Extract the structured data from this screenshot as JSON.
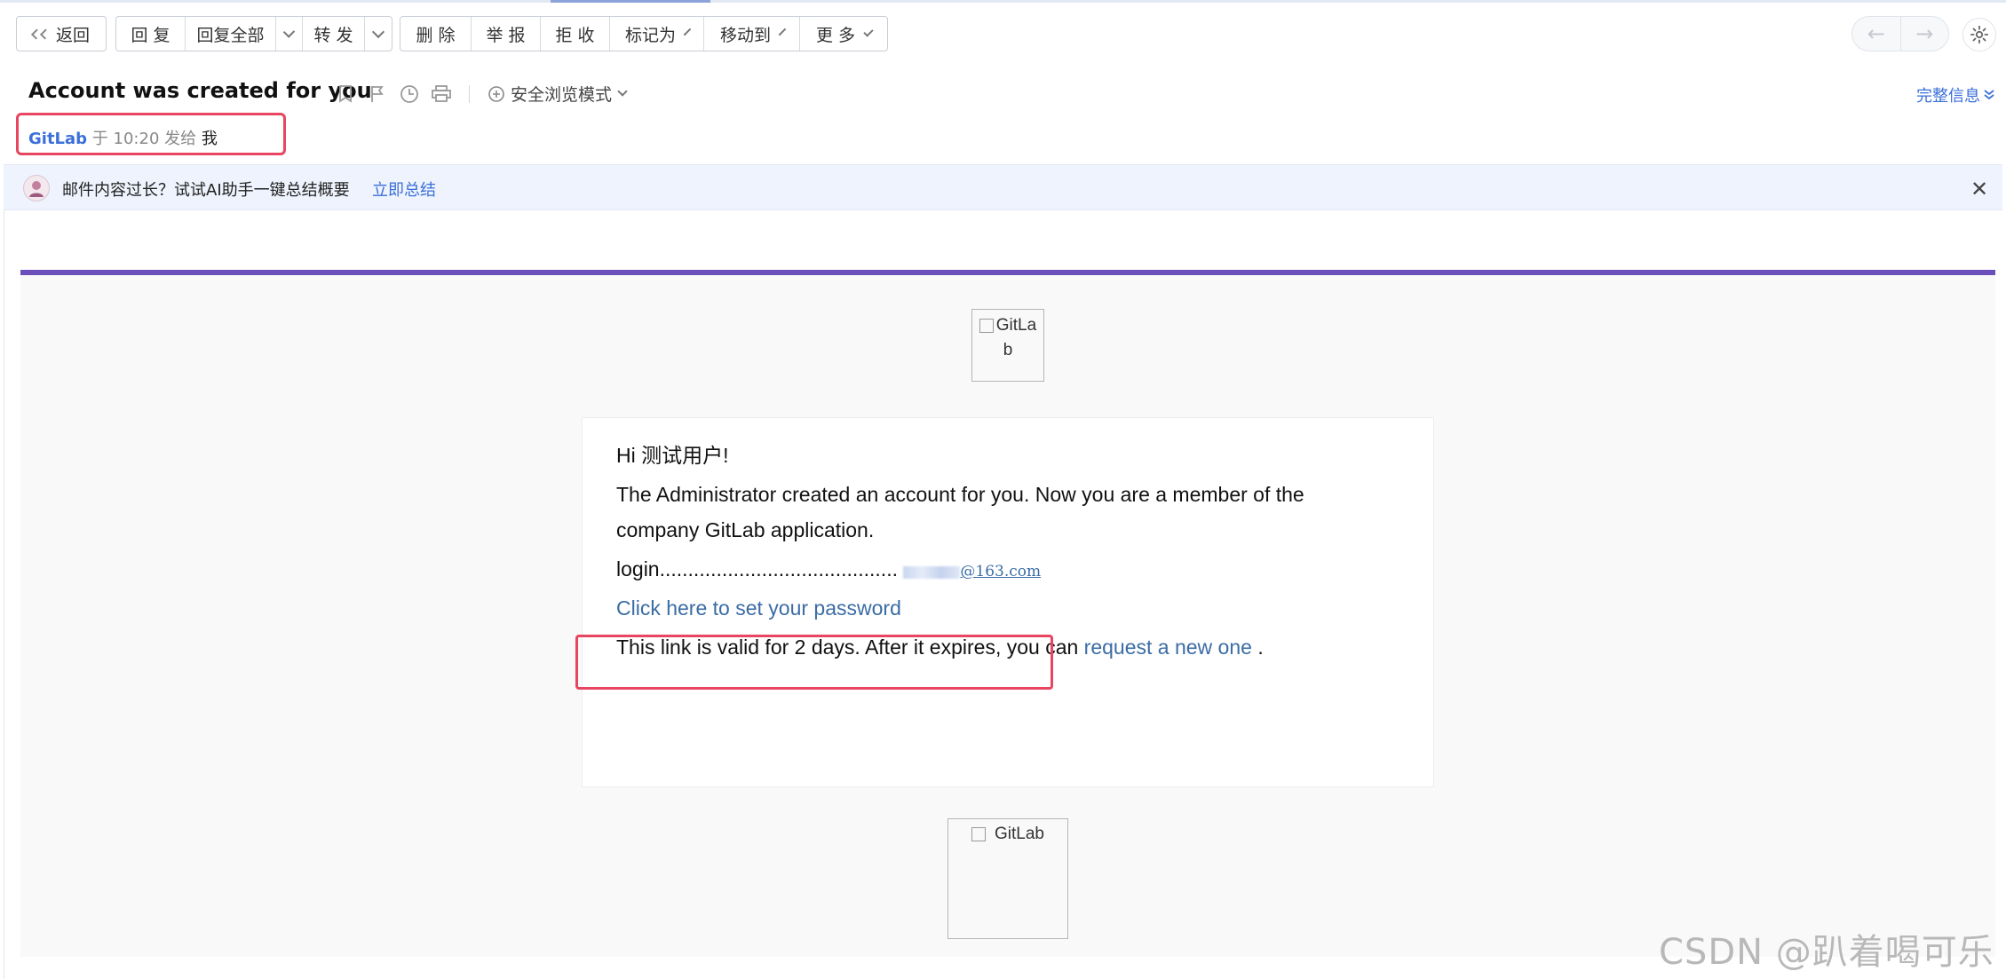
{
  "toolbar": {
    "back": "返回",
    "reply": "回 复",
    "reply_all": "回复全部",
    "forward": "转 发",
    "delete": "删 除",
    "report": "举 报",
    "reject": "拒 收",
    "mark_as": "标记为",
    "move_to": "移动到",
    "more": "更 多"
  },
  "nav": {
    "prev_icon": "←",
    "next_icon": "→"
  },
  "subject": {
    "title": "Account was created for you",
    "safe_mode": "安全浏览模式",
    "full_info": "完整信息"
  },
  "sender": {
    "from": "GitLab",
    "meta": "于 10:20 发给",
    "to": "我"
  },
  "ai_banner": {
    "text": "邮件内容过长？试试AI助手一键总结概要",
    "link": "立即总结",
    "close": "✕"
  },
  "email": {
    "logo_alt": "GitLa b",
    "greeting": "Hi 测试用户!",
    "line1": "The Administrator created an account for you. Now you are a member of the",
    "line2": "company GitLab application.",
    "login_label": "login..........................................",
    "login_domain": "@163.com",
    "set_password_link": "Click here to set your password",
    "valid_text": "This link is valid for 2 days. After it expires, you can",
    "request_link": "request a new one",
    "valid_end": ".",
    "footer_logo_alt": "GitLab"
  },
  "watermark": "CSDN @趴着喝可乐",
  "colors": {
    "accent_link": "#3b6fd9",
    "gitlab_purple": "#6b4fbb",
    "highlight_box": "#e84660"
  }
}
